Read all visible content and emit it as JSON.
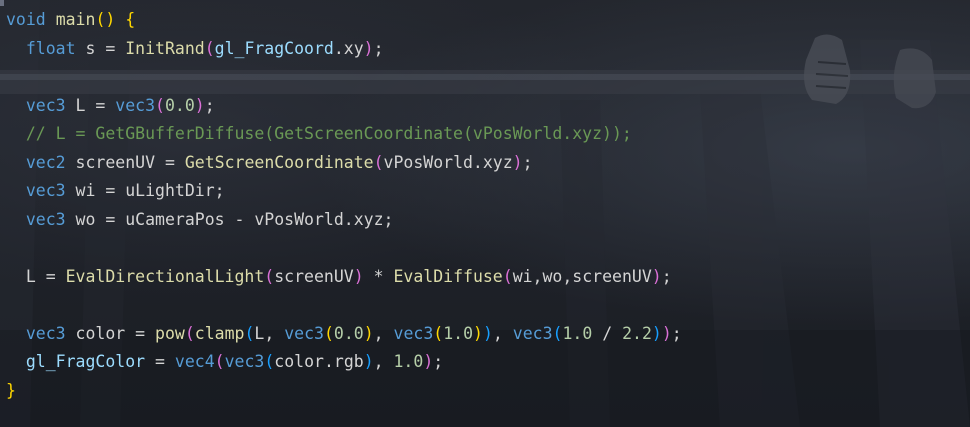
{
  "editor": {
    "lines": [
      [
        [
          "k",
          "void"
        ],
        [
          "v",
          " "
        ],
        [
          "f",
          "main"
        ],
        [
          "b1",
          "()"
        ],
        [
          "v",
          " "
        ],
        [
          "b1",
          "{"
        ]
      ],
      [
        [
          "v",
          "  "
        ],
        [
          "k",
          "float"
        ],
        [
          "v",
          " s = "
        ],
        [
          "f",
          "InitRand"
        ],
        [
          "b2",
          "("
        ],
        [
          "g",
          "gl_FragCoord"
        ],
        [
          "v",
          ".xy"
        ],
        [
          "b2",
          ")"
        ],
        [
          "v",
          ";"
        ]
      ],
      [],
      [
        [
          "v",
          "  "
        ],
        [
          "k",
          "vec3"
        ],
        [
          "v",
          " L = "
        ],
        [
          "k",
          "vec3"
        ],
        [
          "b2",
          "("
        ],
        [
          "n",
          "0.0"
        ],
        [
          "b2",
          ")"
        ],
        [
          "v",
          ";"
        ]
      ],
      [
        [
          "c",
          "  // L = GetGBufferDiffuse(GetScreenCoordinate(vPosWorld.xyz));"
        ]
      ],
      [
        [
          "v",
          "  "
        ],
        [
          "k",
          "vec2"
        ],
        [
          "v",
          " screenUV = "
        ],
        [
          "f",
          "GetScreenCoordinate"
        ],
        [
          "b2",
          "("
        ],
        [
          "v",
          "vPosWorld.xyz"
        ],
        [
          "b2",
          ")"
        ],
        [
          "v",
          ";"
        ]
      ],
      [
        [
          "v",
          "  "
        ],
        [
          "k",
          "vec3"
        ],
        [
          "v",
          " wi = uLightDir;"
        ]
      ],
      [
        [
          "v",
          "  "
        ],
        [
          "k",
          "vec3"
        ],
        [
          "v",
          " wo = uCameraPos - vPosWorld.xyz;"
        ]
      ],
      [],
      [
        [
          "v",
          "  L = "
        ],
        [
          "f",
          "EvalDirectionalLight"
        ],
        [
          "b2",
          "("
        ],
        [
          "v",
          "screenUV"
        ],
        [
          "b2",
          ")"
        ],
        [
          "v",
          " * "
        ],
        [
          "f",
          "EvalDiffuse"
        ],
        [
          "b2",
          "("
        ],
        [
          "v",
          "wi,wo,screenUV"
        ],
        [
          "b2",
          ")"
        ],
        [
          "v",
          ";"
        ]
      ],
      [],
      [
        [
          "v",
          "  "
        ],
        [
          "k",
          "vec3"
        ],
        [
          "v",
          " color = "
        ],
        [
          "f",
          "pow"
        ],
        [
          "b2",
          "("
        ],
        [
          "f",
          "clamp"
        ],
        [
          "b3",
          "("
        ],
        [
          "v",
          "L, "
        ],
        [
          "k",
          "vec3"
        ],
        [
          "b1",
          "("
        ],
        [
          "n",
          "0.0"
        ],
        [
          "b1",
          ")"
        ],
        [
          "v",
          ", "
        ],
        [
          "k",
          "vec3"
        ],
        [
          "b1",
          "("
        ],
        [
          "n",
          "1.0"
        ],
        [
          "b1",
          ")"
        ],
        [
          "b3",
          ")"
        ],
        [
          "v",
          ", "
        ],
        [
          "k",
          "vec3"
        ],
        [
          "b3",
          "("
        ],
        [
          "n",
          "1.0"
        ],
        [
          "v",
          " / "
        ],
        [
          "n",
          "2.2"
        ],
        [
          "b3",
          ")"
        ],
        [
          "b2",
          ")"
        ],
        [
          "v",
          ";"
        ]
      ],
      [
        [
          "v",
          "  "
        ],
        [
          "g",
          "gl_FragColor"
        ],
        [
          "v",
          " = "
        ],
        [
          "k",
          "vec4"
        ],
        [
          "b2",
          "("
        ],
        [
          "k",
          "vec3"
        ],
        [
          "b3",
          "("
        ],
        [
          "v",
          "color.rgb"
        ],
        [
          "b3",
          ")"
        ],
        [
          "v",
          ", "
        ],
        [
          "n",
          "1.0"
        ],
        [
          "b2",
          ")"
        ],
        [
          "v",
          ";"
        ]
      ],
      [
        [
          "b1",
          "}"
        ]
      ]
    ]
  }
}
